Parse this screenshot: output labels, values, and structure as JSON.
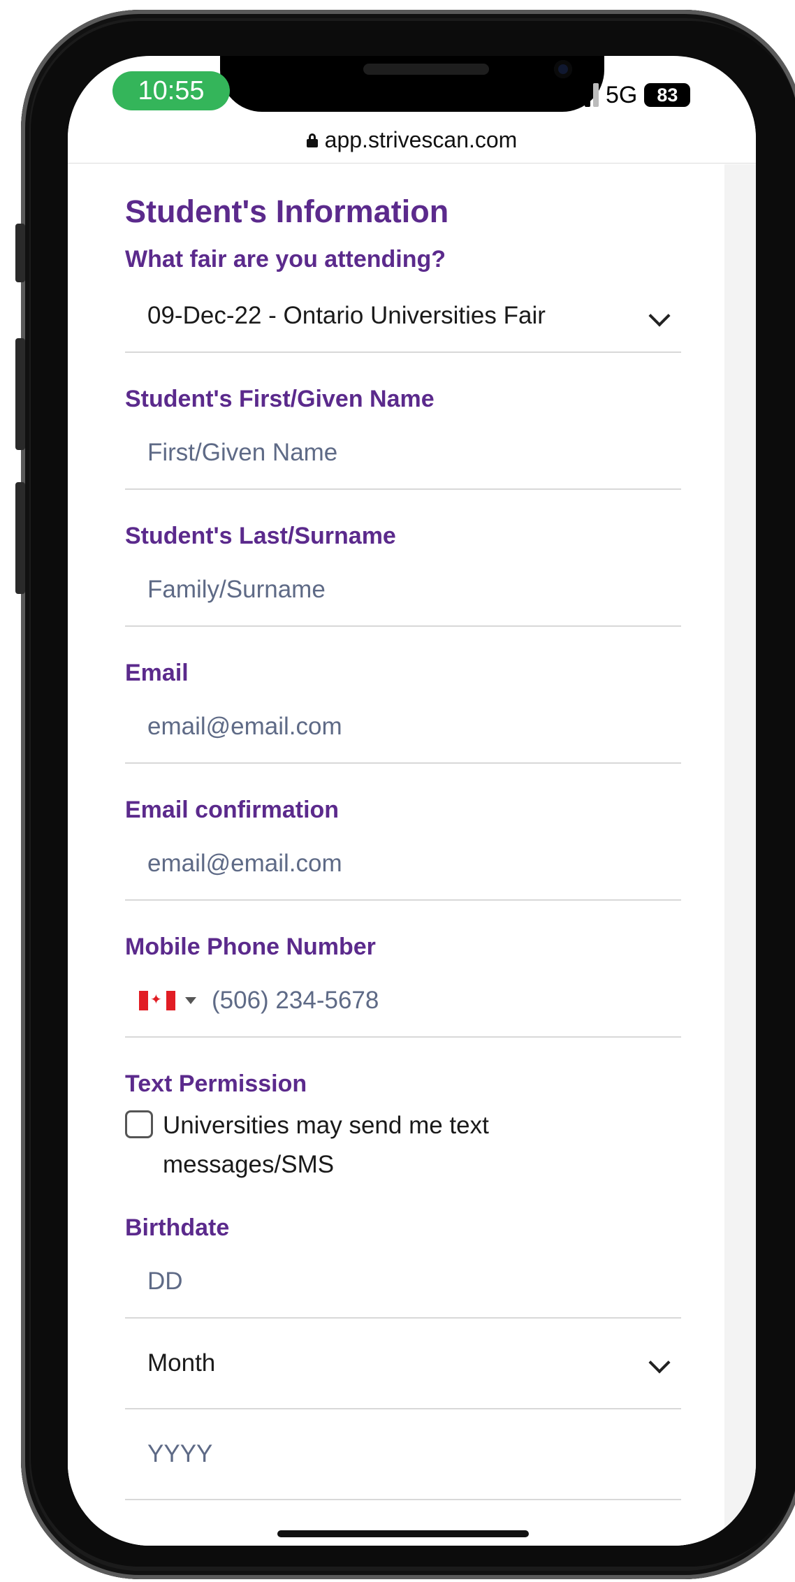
{
  "status_bar": {
    "time": "10:55",
    "network": "5G",
    "battery": "83",
    "time_pill_color": "#34b55a"
  },
  "browser": {
    "url": "app.strivescan.com",
    "lock_icon": "lock-icon"
  },
  "form": {
    "title": "Student's Information",
    "accent_color": "#5b2a8c",
    "fair": {
      "label": "What fair are you attending?",
      "value": "09-Dec-22 - Ontario Universities Fair"
    },
    "first_name": {
      "label": "Student's First/Given Name",
      "placeholder": "First/Given Name"
    },
    "last_name": {
      "label": "Student's Last/Surname",
      "placeholder": "Family/Surname"
    },
    "email": {
      "label": "Email",
      "placeholder": "email@email.com"
    },
    "email_confirm": {
      "label": "Email confirmation",
      "placeholder": "email@email.com"
    },
    "phone": {
      "label": "Mobile Phone Number",
      "placeholder": "(506) 234-5678",
      "country_icon": "canada-flag-icon"
    },
    "text_permission": {
      "label": "Text Permission",
      "checkbox_line1": "Universities may send me text",
      "checkbox_line2": "messages/SMS",
      "checked": false
    },
    "birthdate": {
      "label": "Birthdate",
      "day_placeholder": "DD",
      "month_value": "Month",
      "year_placeholder": "YYYY"
    }
  }
}
